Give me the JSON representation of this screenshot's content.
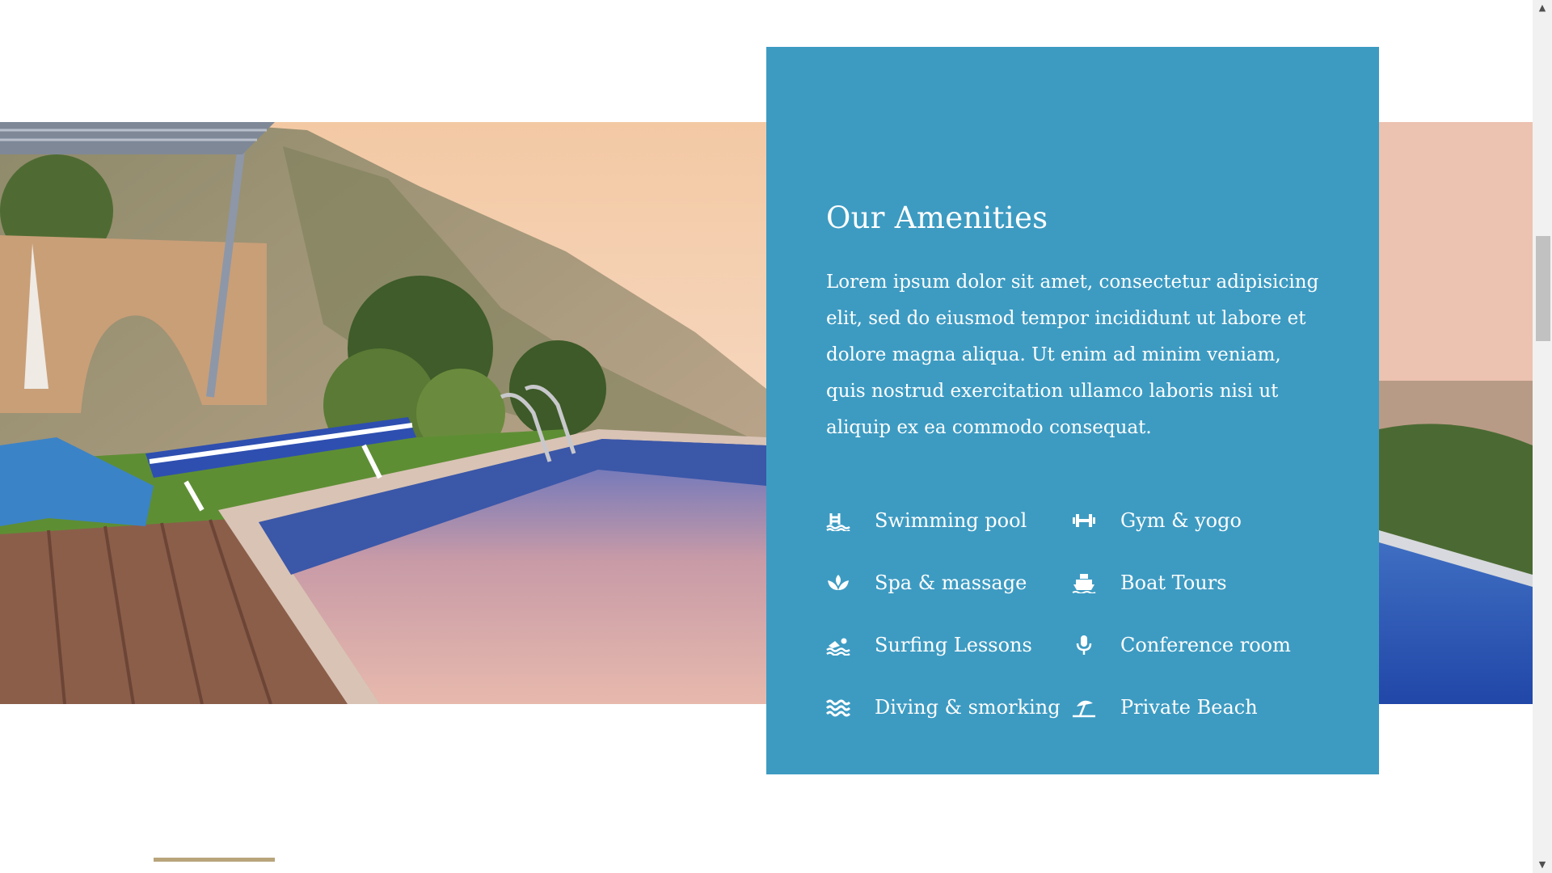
{
  "amenities": {
    "title": "Our Amenities",
    "description": "Lorem ipsum dolor sit amet, consectetur adipisicing elit, sed do eiusmod tempor incididunt ut labore et dolore magna aliqua. Ut enim ad minim veniam, quis nostrud exercitation ullamco laboris nisi ut aliquip ex ea commodo consequat.",
    "items": [
      {
        "label": "Swimming pool",
        "icon": "swimming-pool-icon"
      },
      {
        "label": "Gym & yogo",
        "icon": "dumbbell-icon"
      },
      {
        "label": "Spa & massage",
        "icon": "spa-lotus-icon"
      },
      {
        "label": "Boat Tours",
        "icon": "boat-icon"
      },
      {
        "label": "Surfing Lessons",
        "icon": "swimmer-icon"
      },
      {
        "label": "Conference room",
        "icon": "microphone-icon"
      },
      {
        "label": "Diving & smorking",
        "icon": "waves-icon"
      },
      {
        "label": "Private Beach",
        "icon": "beach-umbrella-icon"
      }
    ]
  },
  "colors": {
    "panel_background": "#3d9bc2",
    "accent_line": "#b8a57a"
  },
  "scrollbar": {
    "up_arrow": "▲",
    "down_arrow": "▼"
  }
}
